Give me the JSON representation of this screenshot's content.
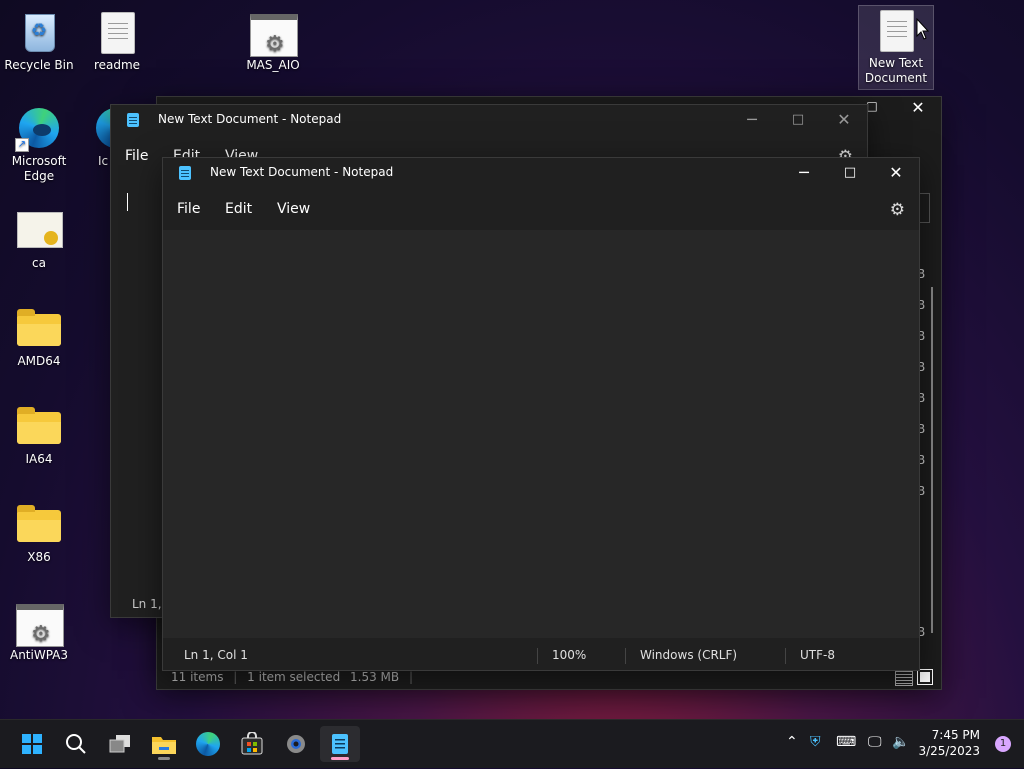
{
  "desktop": {
    "icons": [
      {
        "label": "Recycle Bin"
      },
      {
        "label": "readme"
      },
      {
        "label": "MAS_AIO"
      },
      {
        "label": "New Text Document"
      },
      {
        "label": "Microsoft Edge"
      },
      {
        "label": "Ic"
      },
      {
        "label": "ca"
      },
      {
        "label": "AMD64"
      },
      {
        "label": "IA64"
      },
      {
        "label": "X86"
      },
      {
        "label": "AntiWPA3"
      }
    ]
  },
  "back_window": {
    "title": "New Text Document - Notepad",
    "menu": [
      "File",
      "Edit",
      "View"
    ],
    "status": "Ln 1, C"
  },
  "explorer": {
    "status_items": "11 items",
    "status_selected": "1 item selected",
    "status_size": "1.53 MB",
    "size_suffix": "B"
  },
  "notepad": {
    "title": "New Text Document - Notepad",
    "menu": [
      "File",
      "Edit",
      "View"
    ],
    "content": "",
    "status": {
      "position": "Ln 1, Col 1",
      "zoom": "100%",
      "line_ending": "Windows (CRLF)",
      "encoding": "UTF-8"
    }
  },
  "taskbar": {
    "time": "7:45 PM",
    "date": "3/25/2023",
    "notifications": "1"
  },
  "colors": {
    "accent": "#4cc2ff",
    "editor_bg": "#272727",
    "window_bg": "#202020"
  }
}
